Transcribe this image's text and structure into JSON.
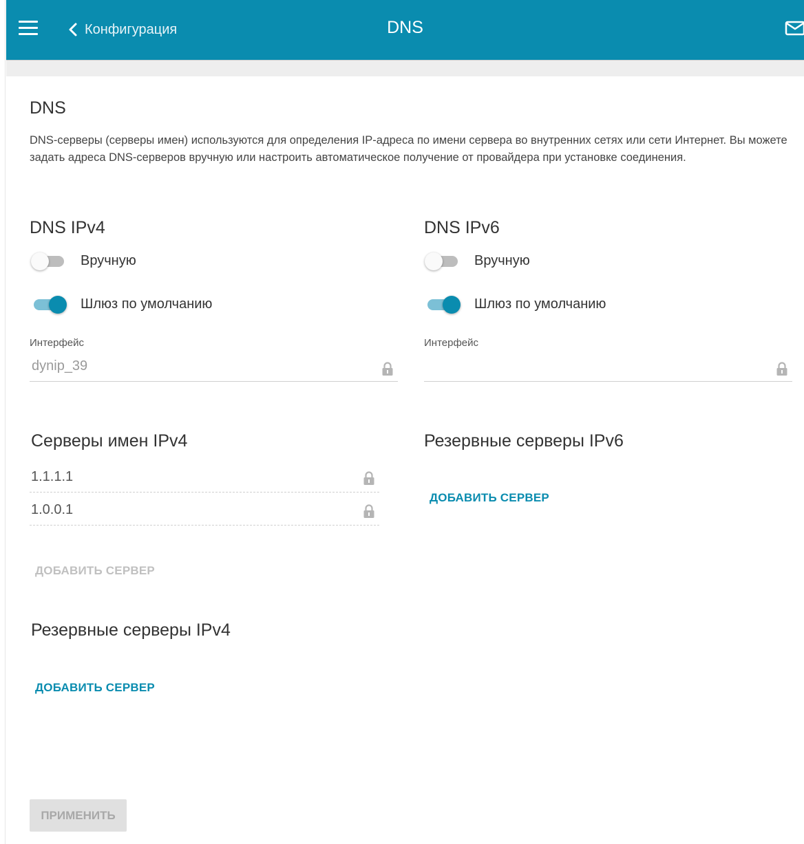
{
  "header": {
    "back_label": "Конфигурация",
    "title": "DNS"
  },
  "section": {
    "title": "DNS",
    "description": "DNS-серверы (серверы имен) используются для определения IP-адреса по имени сервера во внутренних сетях или сети Интернет. Вы можете задать адреса DNS-серверов вручную или настроить автоматическое получение от провайдера при установке соединения."
  },
  "ipv4": {
    "title": "DNS IPv4",
    "manual_label": "Вручную",
    "manual_on": false,
    "gateway_label": "Шлюз по умолчанию",
    "gateway_on": true,
    "interface_label": "Интерфейс",
    "interface_value": "dynip_39",
    "nameservers_title": "Серверы имен IPv4",
    "nameservers": [
      "1.1.1.1",
      "1.0.0.1"
    ],
    "add_server_label": "ДОБАВИТЬ СЕРВЕР",
    "backup_title": "Резервные серверы IPv4",
    "backup_add_label": "ДОБАВИТЬ СЕРВЕР"
  },
  "ipv6": {
    "title": "DNS IPv6",
    "manual_label": "Вручную",
    "manual_on": false,
    "gateway_label": "Шлюз по умолчанию",
    "gateway_on": true,
    "interface_label": "Интерфейс",
    "interface_value": "",
    "backup_title": "Резервные серверы IPv6",
    "backup_add_label": "ДОБАВИТЬ СЕРВЕР"
  },
  "apply_label": "ПРИМЕНИТЬ",
  "colors": {
    "header_bg": "#0a8caf",
    "accent": "#0a8caf",
    "disabled": "#c0c0c0"
  },
  "icons": [
    "menu-icon",
    "chevron-left-icon",
    "mail-icon",
    "lock-icon"
  ]
}
